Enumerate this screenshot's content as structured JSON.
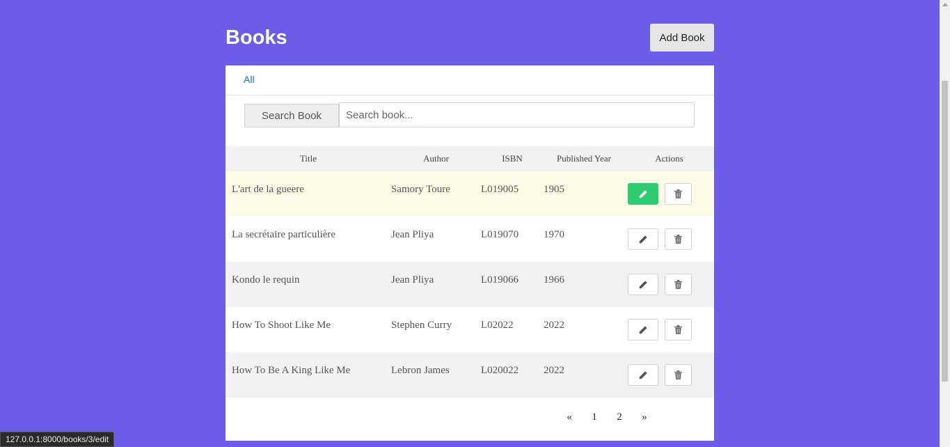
{
  "header": {
    "title": "Books",
    "add_button_label": "Add Book"
  },
  "tabs": {
    "all_label": "All"
  },
  "search": {
    "button_label": "Search Book",
    "placeholder": "Search book...",
    "value": ""
  },
  "table": {
    "columns": [
      "Title",
      "Author",
      "ISBN",
      "Published Year",
      "Actions"
    ],
    "rows": [
      {
        "title": "L'art de la gueere",
        "author": "Samory Toure",
        "isbn": "L019005",
        "year": "1905"
      },
      {
        "title": "La secrétaire particulière",
        "author": "Jean Pliya",
        "isbn": "L019070",
        "year": "1970"
      },
      {
        "title": "Kondo le requin",
        "author": "Jean Pliya",
        "isbn": "L019066",
        "year": "1966"
      },
      {
        "title": "How To Shoot Like Me",
        "author": "Stephen Curry",
        "isbn": "L02022",
        "year": "2022"
      },
      {
        "title": "How To Be A King Like Me",
        "author": "Lebron James",
        "isbn": "L020022",
        "year": "2022"
      }
    ],
    "edit_icon": "pencil-icon",
    "delete_icon": "trash-icon"
  },
  "pagination": {
    "prev": "«",
    "pages": [
      "1",
      "2"
    ],
    "next": "»"
  },
  "status_bar": {
    "url": "127.0.0.1:8000/books/3/edit"
  },
  "colors": {
    "background": "#6c5ce7",
    "edit_active": "#2ecc71",
    "link": "#1a6fb5"
  }
}
